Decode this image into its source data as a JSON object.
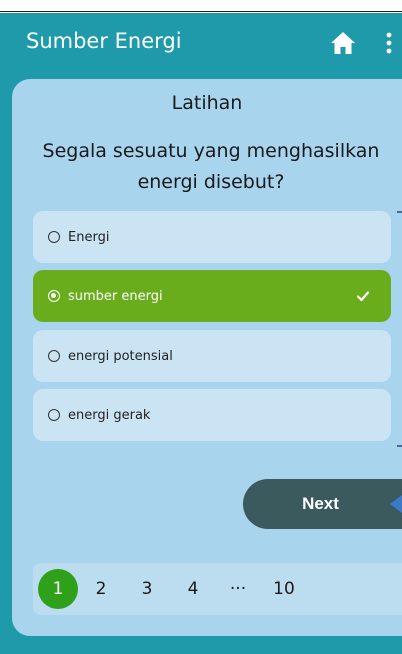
{
  "appbar": {
    "title": "Sumber Energi",
    "home_icon": "home-icon",
    "menu_icon": "more-vertical-icon"
  },
  "quiz": {
    "heading": "Latihan",
    "question": "Segala sesuatu yang menghasilkan energi disebut?",
    "options": [
      {
        "label": "Energi",
        "selected": false
      },
      {
        "label": "sumber energi",
        "selected": true
      },
      {
        "label": "energi potensial",
        "selected": false
      },
      {
        "label": "energi gerak",
        "selected": false
      }
    ]
  },
  "next_label": "Next",
  "pager": {
    "active": "1",
    "pages": [
      "2",
      "3",
      "4",
      "···",
      "10"
    ]
  },
  "colors": {
    "appbar": "#1e9aaa",
    "card": "#a8d4ee",
    "option": "#cbe4f4",
    "selected": "#6aad1c",
    "next_button": "#3a5a5e",
    "active_page": "#2ea01a"
  }
}
